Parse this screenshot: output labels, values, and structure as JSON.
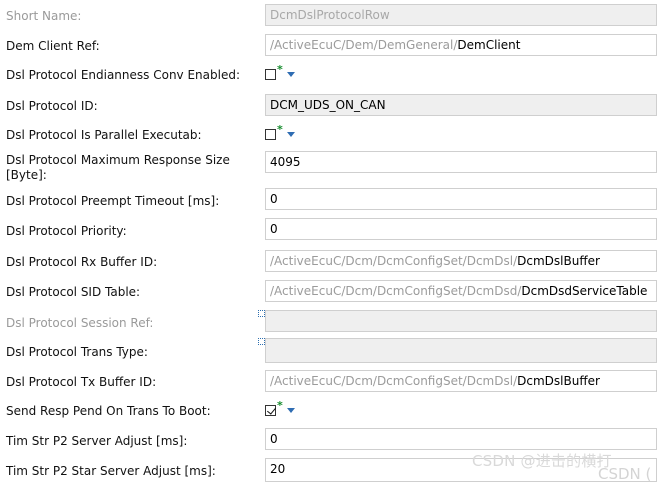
{
  "rows": [
    {
      "label": "Short Name:",
      "label_disabled": true,
      "value": "DcmDslProtocolRow"
    },
    {
      "label": "Dem Client Ref:",
      "path_prefix": "/ActiveEcuC/Dem/DemGeneral/",
      "path_last": "DemClient"
    },
    {
      "label": "Dsl Protocol Endianness Conv Enabled:",
      "checked": false
    },
    {
      "label": "Dsl Protocol ID:",
      "value": "DCM_UDS_ON_CAN"
    },
    {
      "label": "Dsl Protocol Is Parallel Executab:",
      "checked": false
    },
    {
      "label": "Dsl Protocol Maximum Response Size [Byte]:",
      "value": "4095"
    },
    {
      "label": "Dsl Protocol Preempt Timeout [ms]:",
      "value": "0"
    },
    {
      "label": "Dsl Protocol Priority:",
      "value": "0"
    },
    {
      "label": "Dsl Protocol Rx Buffer ID:",
      "path_prefix": "/ActiveEcuC/Dcm/DcmConfigSet/DcmDsl/",
      "path_last": "DcmDslBuffer"
    },
    {
      "label": "Dsl Protocol SID Table:",
      "path_prefix": "/ActiveEcuC/Dcm/DcmConfigSet/DcmDsd/",
      "path_last": "DcmDsdServiceTable"
    },
    {
      "label": "Dsl Protocol Session Ref:",
      "label_disabled": true,
      "value": ""
    },
    {
      "label": "Dsl Protocol Trans Type:",
      "value": ""
    },
    {
      "label": "Dsl Protocol Tx Buffer ID:",
      "path_prefix": "/ActiveEcuC/Dcm/DcmConfigSet/DcmDsl/",
      "path_last": "DcmDslBuffer"
    },
    {
      "label": "Send Resp Pend On Trans To Boot:",
      "checked": true
    },
    {
      "label": "Tim Str P2 Server Adjust [ms]:",
      "value": "0"
    },
    {
      "label": "Tim Str P2 Star Server Adjust [ms]:",
      "value": "20"
    }
  ],
  "checkbox_marker": "*",
  "watermark": "CSDN @进击的横打",
  "watermark_fragment": "CSDN ("
}
